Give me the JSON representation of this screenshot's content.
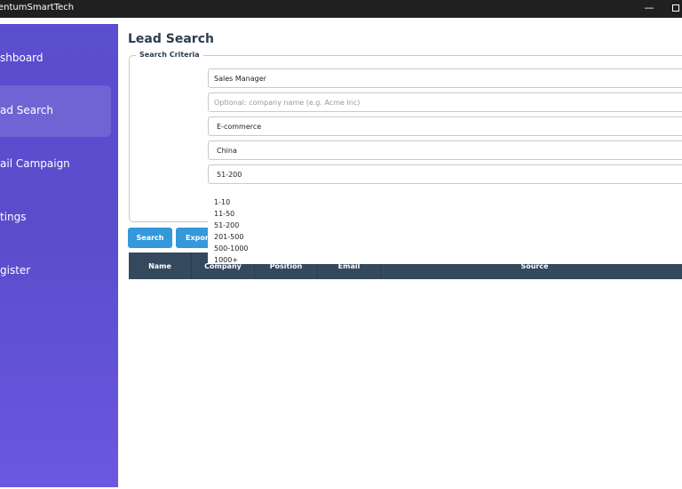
{
  "window": {
    "title": "entumSmartTech",
    "minimize_glyph": "—"
  },
  "sidebar": {
    "items": [
      {
        "label": "shboard",
        "active": false
      },
      {
        "label": "ad Search",
        "active": true
      },
      {
        "label": "ail Campaign",
        "active": false
      },
      {
        "label": "tings",
        "active": false
      },
      {
        "label": "gister",
        "active": false
      }
    ]
  },
  "main": {
    "title": "Lead Search",
    "criteria_legend": "Search Criteria",
    "fields": {
      "position": "Sales Manager",
      "company_placeholder": "Optional: company name (e.g. Acme Inc)",
      "industry": "E-commerce",
      "country": "China",
      "company_size": "51-200"
    },
    "size_options": [
      "1-10",
      "11-50",
      "51-200",
      "201-500",
      "500-1000",
      "1000+"
    ],
    "buttons": {
      "search": "Search",
      "export": "Export"
    },
    "table": {
      "columns": [
        "Name",
        "Company",
        "Position",
        "Email",
        "Source"
      ]
    }
  },
  "colors": {
    "sidebar": "#5a4fcf",
    "accent": "#3498db",
    "table_header": "#34495e",
    "title_text": "#2c3e50"
  }
}
